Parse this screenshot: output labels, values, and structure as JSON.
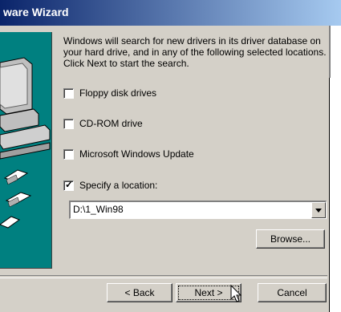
{
  "window": {
    "title": "ware Wizard"
  },
  "description": "Windows will search for new drivers in its driver database on your hard drive, and in any of the following selected locations. Click Next to start the search.",
  "options": [
    {
      "label": "Floppy disk drives",
      "checked": false
    },
    {
      "label": "CD-ROM drive",
      "checked": false
    },
    {
      "label": "Microsoft Windows Update",
      "checked": false
    },
    {
      "label": "Specify a location:",
      "checked": true
    }
  ],
  "location": {
    "value": "D:\\1_Win98"
  },
  "buttons": {
    "browse": "Browse...",
    "back": "< Back",
    "next": "Next >",
    "cancel": "Cancel"
  },
  "colors": {
    "title_start": "#0a246a",
    "title_end": "#a6caf0",
    "dialog": "#d4d0c8",
    "graphic_bg": "#008080"
  },
  "icons": [
    "computer-graphic",
    "disk-icon",
    "chevron-down-icon",
    "mouse-pointer-icon"
  ]
}
